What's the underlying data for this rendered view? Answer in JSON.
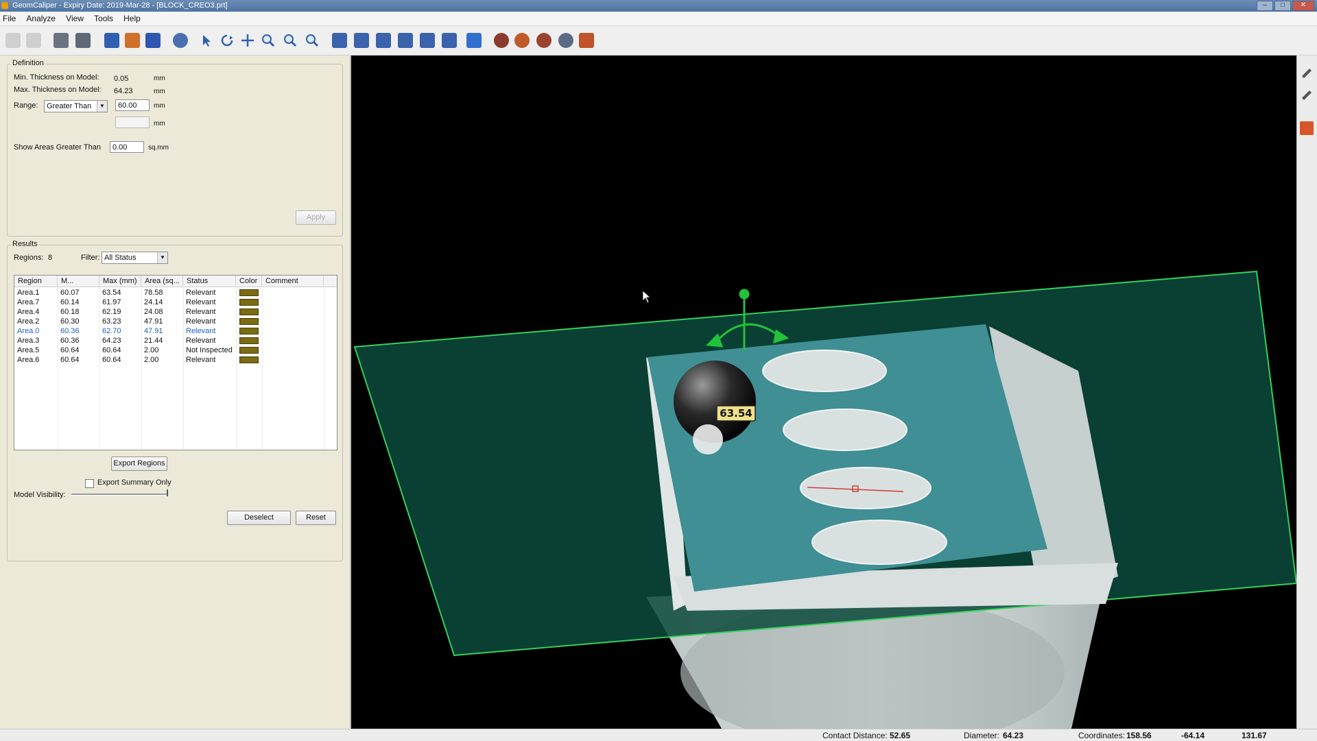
{
  "window": {
    "title": "GeomCaliper - Expiry Date: 2019-Mar-28 - [BLOCK_CREO3.prt]"
  },
  "menu": [
    "File",
    "Analyze",
    "View",
    "Tools",
    "Help"
  ],
  "definition": {
    "title": "Definition",
    "min_label": "Min. Thickness on Model:",
    "min_value": "0.05",
    "max_label": "Max. Thickness on Model:",
    "max_value": "64.23",
    "unit_mm": "mm",
    "range_label": "Range:",
    "range_mode": "Greater Than",
    "range_value": "60.00",
    "range_value2": "",
    "areas_label": "Show Areas Greater Than",
    "areas_value": "0.00",
    "areas_unit": "sq.mm",
    "apply_label": "Apply"
  },
  "results": {
    "title": "Results",
    "regions_label": "Regions:",
    "regions_count": "8",
    "filter_label": "Filter:",
    "filter_value": "All Status",
    "columns": [
      "Region",
      "M...",
      "Max (mm)",
      "Area (sq...",
      "Status",
      "Color",
      "Comment"
    ],
    "rows": [
      {
        "region": "Area.1",
        "min": "60.07",
        "max": "63.54",
        "area": "78.58",
        "status": "Relevant"
      },
      {
        "region": "Area.7",
        "min": "60.14",
        "max": "61.97",
        "area": "24.14",
        "status": "Relevant"
      },
      {
        "region": "Area.4",
        "min": "60.18",
        "max": "62.19",
        "area": "24.08",
        "status": "Relevant"
      },
      {
        "region": "Area.2",
        "min": "60.30",
        "max": "63.23",
        "area": "47.91",
        "status": "Relevant"
      },
      {
        "region": "Area.0",
        "min": "60.36",
        "max": "62.70",
        "area": "47.91",
        "status": "Relevant"
      },
      {
        "region": "Area.3",
        "min": "60.36",
        "max": "64.23",
        "area": "21.44",
        "status": "Relevant"
      },
      {
        "region": "Area.5",
        "min": "60.64",
        "max": "60.64",
        "area": "2.00",
        "status": "Not Inspected"
      },
      {
        "region": "Area.6",
        "min": "60.64",
        "max": "60.64",
        "area": "2.00",
        "status": "Relevant"
      }
    ],
    "export_regions_label": "Export Regions",
    "export_summary_label": "Export Summary Only",
    "model_visibility_label": "Model Visibility:",
    "deselect_label": "Deselect",
    "reset_label": "Reset"
  },
  "viewport": {
    "probe_label": "63.54"
  },
  "status": {
    "contact_label": "Contact Distance:",
    "contact_value": "52.65",
    "diameter_label": "Diameter:",
    "diameter_value": "64.23",
    "coords_label": "Coordinates:",
    "coord_x": "158.56",
    "coord_y": "-64.14",
    "coord_z": "131.67"
  },
  "colors": {
    "plane": "#0c4a3c",
    "part_top": "#3f8f94",
    "part_body": "#c9d2d1",
    "swatch": "#7a6b14",
    "selected_row": "#2060c0",
    "manipulator": "#22c23a"
  }
}
